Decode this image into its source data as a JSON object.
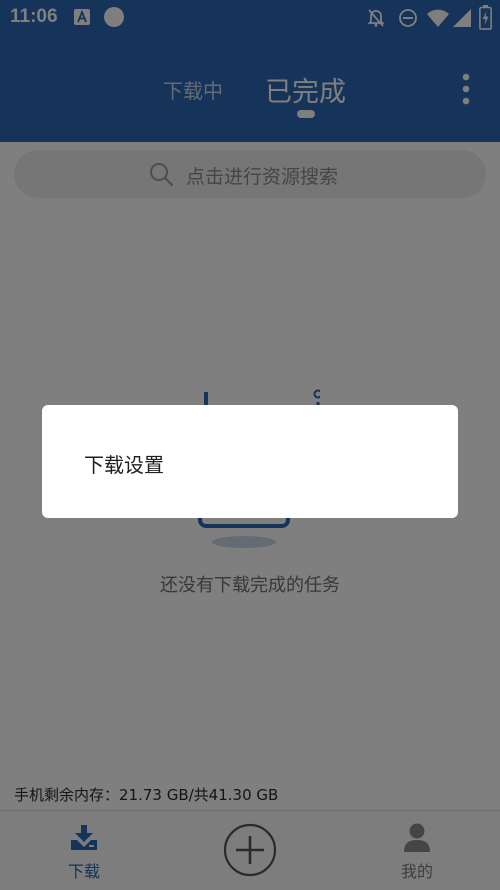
{
  "status_bar": {
    "time": "11:06",
    "icons": [
      "a-notification-icon",
      "circle-icon",
      "bell-off-icon",
      "do-not-disturb-icon",
      "wifi-icon",
      "signal-icon",
      "battery-charging-icon"
    ]
  },
  "header": {
    "tabs": [
      {
        "label": "下载中",
        "selected": false
      },
      {
        "label": "已完成",
        "selected": true
      }
    ],
    "menu_icon": "more-vertical-icon"
  },
  "search": {
    "placeholder": "点击进行资源搜索",
    "icon": "search-icon"
  },
  "empty_state": {
    "message": "还没有下载完成的任务",
    "icon": "empty-box-illustration"
  },
  "storage": {
    "text": "手机剩余内存：21.73 GB/共41.30 GB"
  },
  "bottom_nav": {
    "items": [
      {
        "label": "下载",
        "icon": "download-icon",
        "active": true
      },
      {
        "label": "",
        "icon": "add-circle-icon",
        "active": false
      },
      {
        "label": "我的",
        "icon": "user-icon",
        "active": false
      }
    ]
  },
  "dialog": {
    "items": [
      {
        "label": "下载设置"
      }
    ]
  },
  "colors": {
    "primary": "#2d68b2",
    "overlay": "rgba(0,0,0,0.5)"
  }
}
